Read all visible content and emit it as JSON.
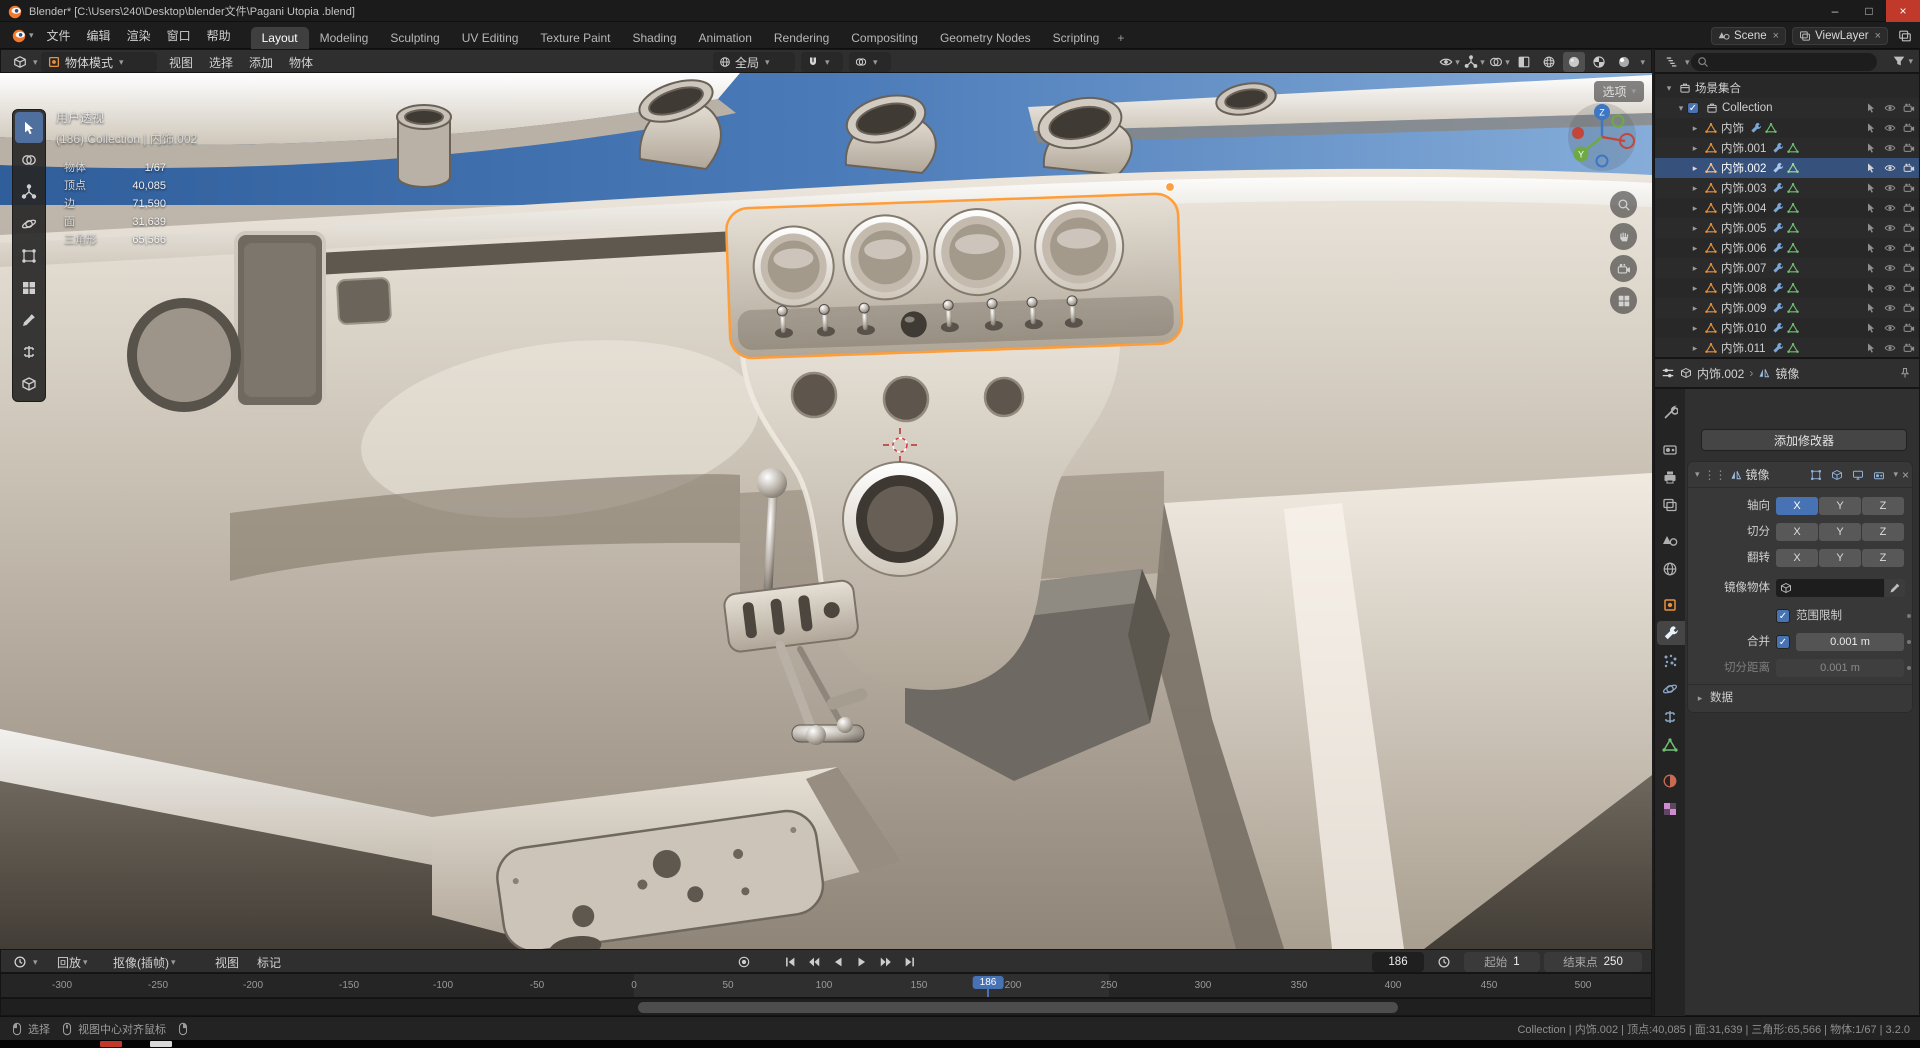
{
  "window": {
    "title": "Blender* [C:\\Users\\240\\Desktop\\blender文件\\Pagani Utopia .blend]"
  },
  "glyphs": {
    "chevron_down": "▾",
    "disclosure": "▸",
    "disclosure_open": "▾",
    "breadcrumb_sep": "›",
    "close": "×",
    "check": "✓",
    "minimize": "–",
    "maximize": "□",
    "dot": "•",
    "drag": "⋮⋮"
  },
  "topbar": {
    "menus": [
      "文件",
      "编辑",
      "渲染",
      "窗口",
      "帮助"
    ],
    "workspaces": [
      "Layout",
      "Modeling",
      "Sculpting",
      "UV Editing",
      "Texture Paint",
      "Shading",
      "Animation",
      "Rendering",
      "Compositing",
      "Geometry Nodes",
      "Scripting"
    ],
    "add_workspace": "+",
    "scene": "Scene",
    "view_layer": "ViewLayer"
  },
  "viewport": {
    "header": {
      "mode": "物体模式",
      "menus": [
        "视图",
        "选择",
        "添加",
        "物体"
      ],
      "orientation": "全局",
      "options": "选项"
    },
    "overlay": {
      "view_name": "用户透视",
      "context": "(186) Collection | 内饰.002",
      "stats": [
        {
          "label": "物体",
          "value": "1/67"
        },
        {
          "label": "顶点",
          "value": "40,085"
        },
        {
          "label": "边",
          "value": "71,590"
        },
        {
          "label": "面",
          "value": "31,639"
        },
        {
          "label": "三角形",
          "value": "65,566"
        }
      ]
    },
    "gizmo": {
      "x": "X",
      "y": "Y",
      "z": "Z"
    }
  },
  "outliner": {
    "scene_collection": "场景集合",
    "collection": "Collection",
    "items": [
      "内饰",
      "内饰.001",
      "内饰.002",
      "内饰.003",
      "内饰.004",
      "内饰.005",
      "内饰.006",
      "内饰.007",
      "内饰.008",
      "内饰.009",
      "内饰.010",
      "内饰.011"
    ],
    "selected_item": "内饰.002"
  },
  "properties": {
    "breadcrumb": {
      "object": "内饰.002",
      "modifier": "镜像"
    },
    "add_modifier": "添加修改器",
    "modifier": {
      "name": "镜像",
      "axis_label": "轴向",
      "bisect_label": "切分",
      "flip_label": "翻转",
      "axis_options": [
        "X",
        "Y",
        "Z"
      ],
      "mirror_object_label": "镜像物体",
      "clipping_label": "范围限制",
      "merge_label": "合并",
      "merge_value": "0.001 m",
      "bisect_distance_label": "切分距离",
      "bisect_distance_value": "0.001 m",
      "data_label": "数据"
    }
  },
  "timeline": {
    "menus": [
      "回放",
      "抠像(插帧)",
      "视图",
      "标记"
    ],
    "current_frame": "186",
    "start_label": "起始",
    "start_value": "1",
    "end_label": "结束点",
    "end_value": "250",
    "ticks": [
      "-300",
      "-250",
      "-200",
      "-150",
      "-100",
      "-50",
      "0",
      "50",
      "100",
      "150",
      "200",
      "250",
      "300",
      "350",
      "400",
      "450",
      "500"
    ]
  },
  "status_bar": {
    "select_hint": "选择",
    "center_hint": "视图中心对齐鼠标",
    "info": "Collection | 内饰.002 | 顶点:40,085 | 面:31,639 | 三角形:65,566 | 物体:1/67 | 3.2.0"
  }
}
